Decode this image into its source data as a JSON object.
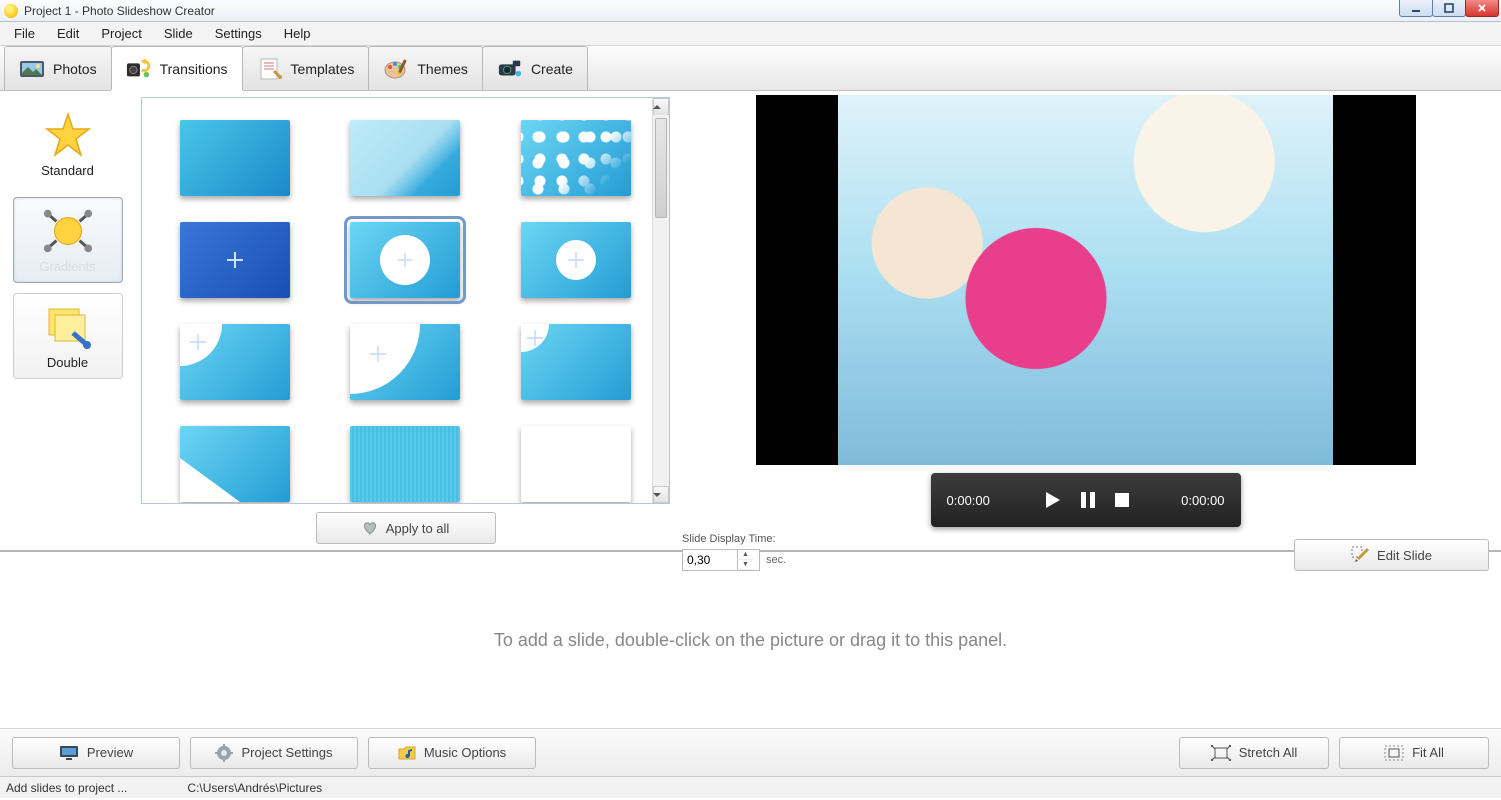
{
  "window": {
    "title": "Project 1 - Photo Slideshow Creator"
  },
  "menu": {
    "file": "File",
    "edit": "Edit",
    "project": "Project",
    "slide": "Slide",
    "settings": "Settings",
    "help": "Help"
  },
  "tabs": {
    "photos": "Photos",
    "transitions": "Transitions",
    "templates": "Templates",
    "themes": "Themes",
    "create": "Create"
  },
  "categories": {
    "standard": "Standard",
    "gradients": "Gradients",
    "double": "Double"
  },
  "apply_all": "Apply to all",
  "player": {
    "elapsed": "0:00:00",
    "total": "0:00:00"
  },
  "slide_display": {
    "label": "Slide Display Time:",
    "value": "0,30",
    "unit": "sec."
  },
  "edit_slide": "Edit Slide",
  "timeline_hint": "To add a slide, double-click on the picture or drag it to this panel.",
  "bottom": {
    "preview": "Preview",
    "project_settings": "Project Settings",
    "music_options": "Music Options",
    "stretch_all": "Stretch All",
    "fit_all": "Fit All"
  },
  "status": {
    "left": "Add slides to project ...",
    "path": "C:\\Users\\Andrés\\Pictures"
  }
}
